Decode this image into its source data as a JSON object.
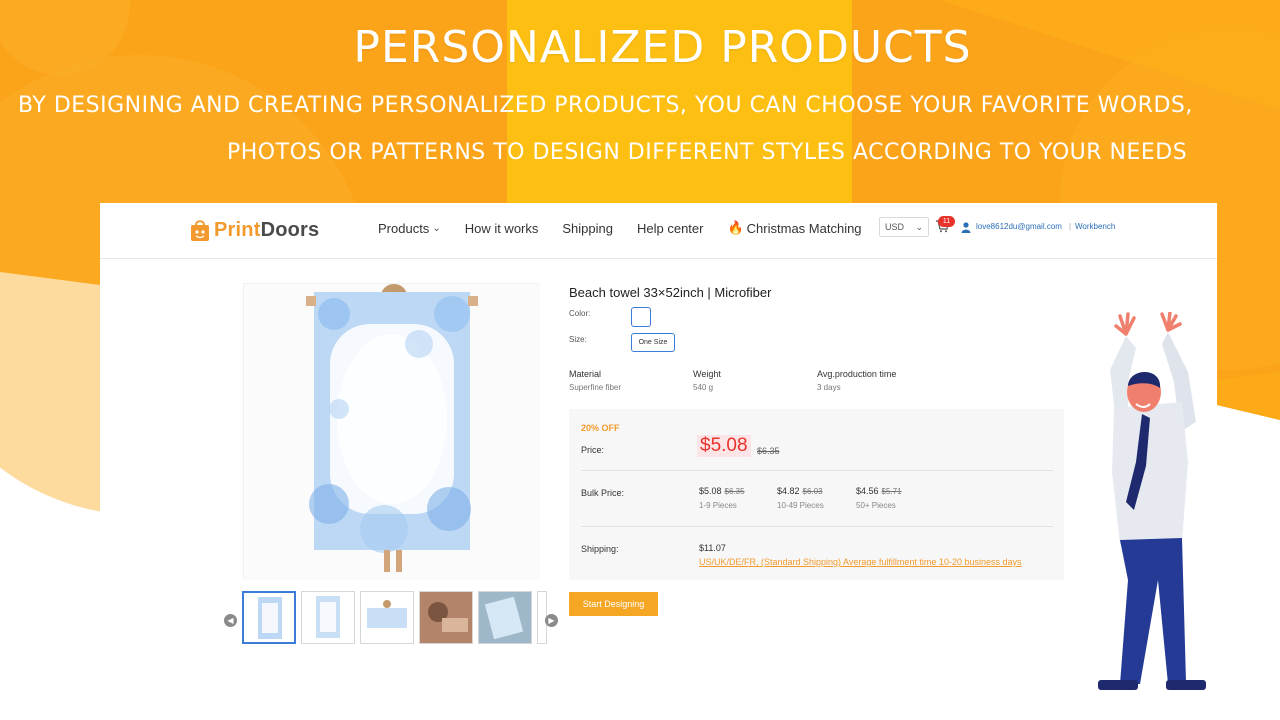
{
  "banner": {
    "title": "PERSONALIZED PRODUCTS",
    "subtitle_line1": "BY DESIGNING AND CREATING PERSONALIZED PRODUCTS, YOU CAN CHOOSE YOUR FAVORITE WORDS,",
    "subtitle_line2": "PHOTOS OR PATTERNS TO DESIGN DIFFERENT STYLES ACCORDING TO YOUR NEEDS",
    "colors": {
      "primary": "#fca119",
      "secondary": "#fdb61a",
      "accent": "#fdc40d"
    }
  },
  "header": {
    "logo_text": "PrintDoors",
    "nav": [
      {
        "label": "Products",
        "icon": "chevron-down-icon"
      },
      {
        "label": "How it works"
      },
      {
        "label": "Shipping"
      },
      {
        "label": "Help center"
      },
      {
        "label": "Christmas Matching",
        "icon": "fire-icon"
      }
    ],
    "currency": "USD",
    "cart_count": "11",
    "user_email": "love8612du@gmail.com",
    "workbench": "Workbench"
  },
  "product": {
    "title": "Beach towel 33×52inch | Microfiber",
    "color_label": "Color:",
    "size_label": "Size:",
    "size_value": "One Size",
    "specs": [
      {
        "label": "Material",
        "value": "Superfine fiber"
      },
      {
        "label": "Weight",
        "value": "540 g"
      },
      {
        "label": "Avg.production time",
        "value": "3 days"
      }
    ],
    "discount": "20% OFF",
    "price_label": "Price:",
    "price": "$5.08",
    "price_original": "$6.35",
    "bulk_label": "Bulk Price:",
    "bulk": [
      {
        "price": "$5.08",
        "original": "$6.35",
        "range": "1-9 Pieces"
      },
      {
        "price": "$4.82",
        "original": "$6.03",
        "range": "10-49 Pieces"
      },
      {
        "price": "$4.56",
        "original": "$5.71",
        "range": "50+ Pieces"
      }
    ],
    "shipping_label": "Shipping:",
    "shipping_price": "$11.07",
    "shipping_info": "US/UK/DE/FR, (Standard Shipping) Average fulfillment time 10-20 business days",
    "cta": "Start Designing"
  }
}
